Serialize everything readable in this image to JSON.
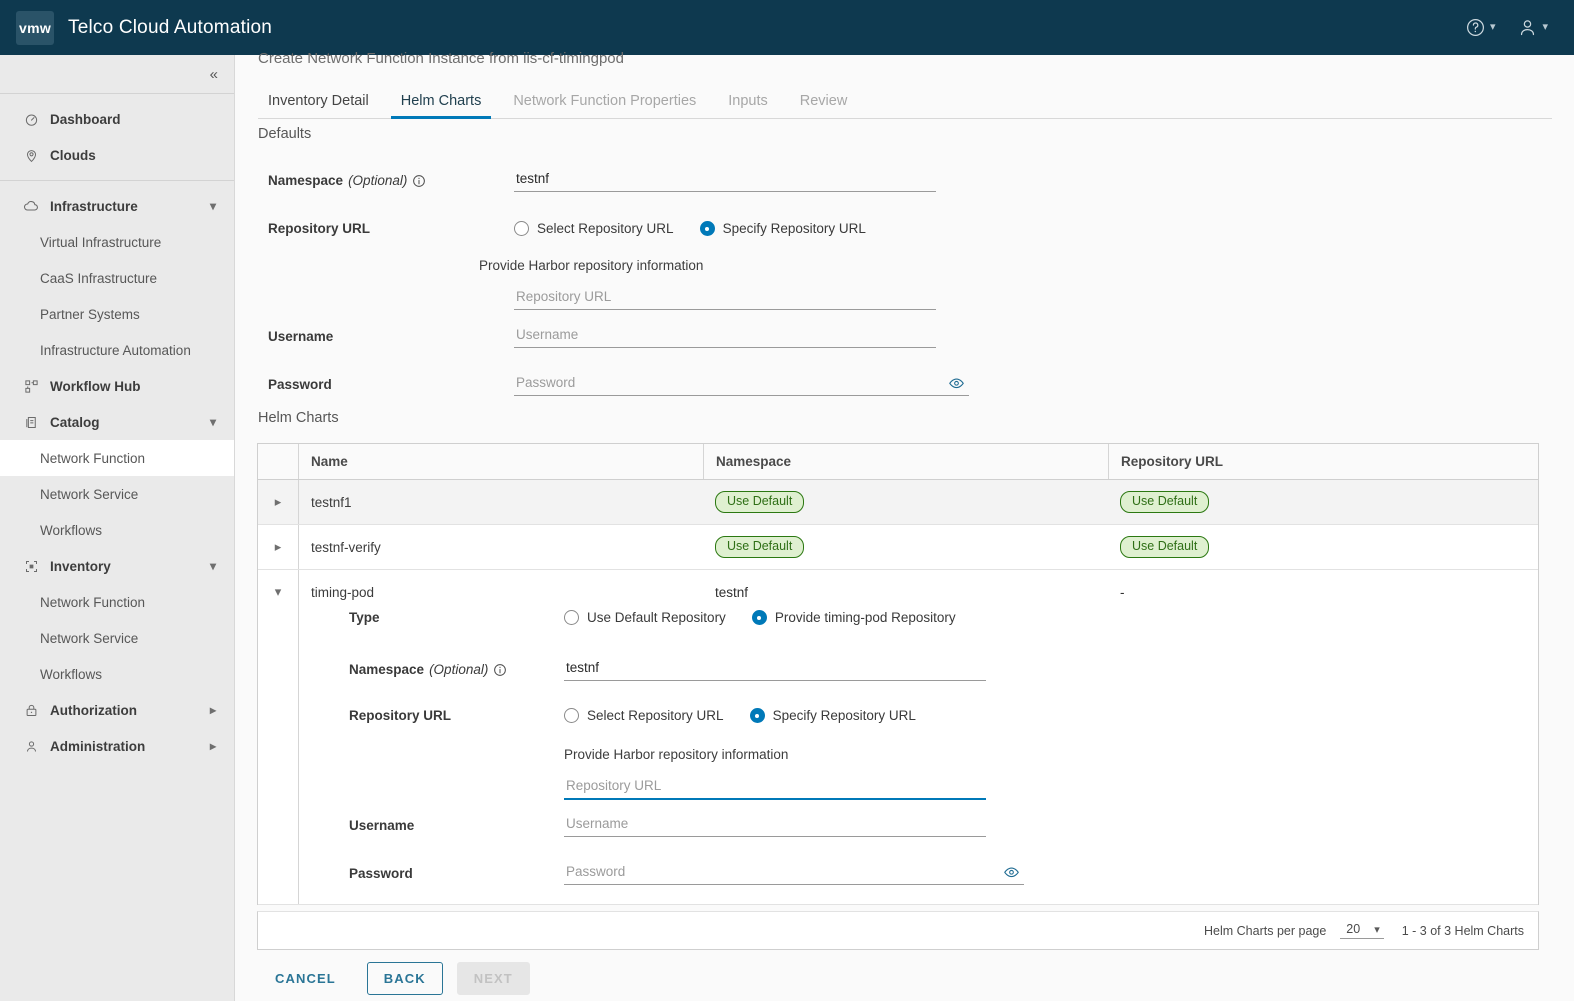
{
  "header": {
    "logo_text": "vmw",
    "app_title": "Telco Cloud Automation",
    "help_icon": "help-circle-icon",
    "user_icon": "user-icon"
  },
  "sidebar": {
    "collapse_label": "«",
    "groups": [
      {
        "items": [
          {
            "label": "Dashboard",
            "icon": "dashboard-icon",
            "level": "top"
          },
          {
            "label": "Clouds",
            "icon": "cloud-pin-icon",
            "level": "top"
          }
        ]
      },
      {
        "items": [
          {
            "label": "Infrastructure",
            "icon": "cloud-icon",
            "level": "top",
            "chevron": "down"
          },
          {
            "label": "Virtual Infrastructure",
            "level": "sub"
          },
          {
            "label": "CaaS Infrastructure",
            "level": "sub"
          },
          {
            "label": "Partner Systems",
            "level": "sub"
          },
          {
            "label": "Infrastructure Automation",
            "level": "sub"
          },
          {
            "label": "Workflow Hub",
            "icon": "workflow-icon",
            "level": "top"
          },
          {
            "label": "Catalog",
            "icon": "catalog-icon",
            "level": "top",
            "chevron": "down"
          },
          {
            "label": "Network Function",
            "level": "sub",
            "active": true
          },
          {
            "label": "Network Service",
            "level": "sub"
          },
          {
            "label": "Workflows",
            "level": "sub"
          },
          {
            "label": "Inventory",
            "icon": "inventory-icon",
            "level": "top",
            "chevron": "down"
          },
          {
            "label": "Network Function",
            "level": "sub"
          },
          {
            "label": "Network Service",
            "level": "sub"
          },
          {
            "label": "Workflows",
            "level": "sub"
          },
          {
            "label": "Authorization",
            "icon": "lock-icon",
            "level": "top",
            "chevron": "right"
          },
          {
            "label": "Administration",
            "icon": "person-icon",
            "level": "top",
            "chevron": "right"
          }
        ]
      }
    ]
  },
  "wizard": {
    "title": "Create Network Function Instance from iis-cf-timingpod",
    "tabs": [
      {
        "label": "Inventory Detail",
        "state": "enabled"
      },
      {
        "label": "Helm Charts",
        "state": "active"
      },
      {
        "label": "Network Function Properties",
        "state": "disabled"
      },
      {
        "label": "Inputs",
        "state": "disabled"
      },
      {
        "label": "Review",
        "state": "disabled"
      }
    ]
  },
  "defaults": {
    "section_label": "Defaults",
    "namespace": {
      "label": "Namespace",
      "optional": "(Optional)",
      "info_icon": "info-icon",
      "value": "testnf"
    },
    "repository_url": {
      "label": "Repository URL",
      "options": [
        {
          "label": "Select Repository URL",
          "selected": false
        },
        {
          "label": "Specify Repository URL",
          "selected": true
        }
      ],
      "harbor_note": "Provide Harbor repository information",
      "url_placeholder": "Repository URL",
      "url_value": ""
    },
    "username": {
      "label": "Username",
      "placeholder": "Username",
      "value": ""
    },
    "password": {
      "label": "Password",
      "placeholder": "Password",
      "value": "",
      "reveal_icon": "eye-icon"
    }
  },
  "helm_charts": {
    "section_label": "Helm Charts",
    "columns": [
      "Name",
      "Namespace",
      "Repository URL"
    ],
    "rows": [
      {
        "name": "testnf1",
        "namespace": "Use Default",
        "namespace_type": "badge",
        "repository": "Use Default",
        "repository_type": "badge",
        "expanded": false
      },
      {
        "name": "testnf-verify",
        "namespace": "Use Default",
        "namespace_type": "badge",
        "repository": "Use Default",
        "repository_type": "badge",
        "expanded": false
      },
      {
        "name": "timing-pod",
        "namespace": "testnf",
        "namespace_type": "text",
        "repository": "-",
        "repository_type": "text",
        "expanded": true
      }
    ],
    "expanded_detail": {
      "type": {
        "label": "Type",
        "options": [
          {
            "label": "Use Default Repository",
            "selected": false
          },
          {
            "label": "Provide timing-pod Repository",
            "selected": true
          }
        ]
      },
      "namespace": {
        "label": "Namespace",
        "optional": "(Optional)",
        "info_icon": "info-icon",
        "value": "testnf"
      },
      "repository_url": {
        "label": "Repository URL",
        "options": [
          {
            "label": "Select Repository URL",
            "selected": false
          },
          {
            "label": "Specify Repository URL",
            "selected": true
          }
        ],
        "harbor_note": "Provide Harbor repository information",
        "url_placeholder": "Repository URL",
        "url_value": ""
      },
      "username": {
        "label": "Username",
        "placeholder": "Username",
        "value": ""
      },
      "password": {
        "label": "Password",
        "placeholder": "Password",
        "value": "",
        "reveal_icon": "eye-icon"
      }
    },
    "pagination": {
      "per_page_label": "Helm Charts per page",
      "per_page_value": "20",
      "range_text": "1 - 3 of 3 Helm Charts"
    }
  },
  "actions": {
    "cancel": "CANCEL",
    "back": "BACK",
    "next": "NEXT"
  },
  "colors": {
    "header_bg": "#0e394f",
    "accent_blue": "#0079b8",
    "badge_green_bg": "#dff0d0",
    "badge_green_border": "#2b7811",
    "badge_green_text": "#2f6f16",
    "sidebar_bg": "#eaeaea"
  }
}
